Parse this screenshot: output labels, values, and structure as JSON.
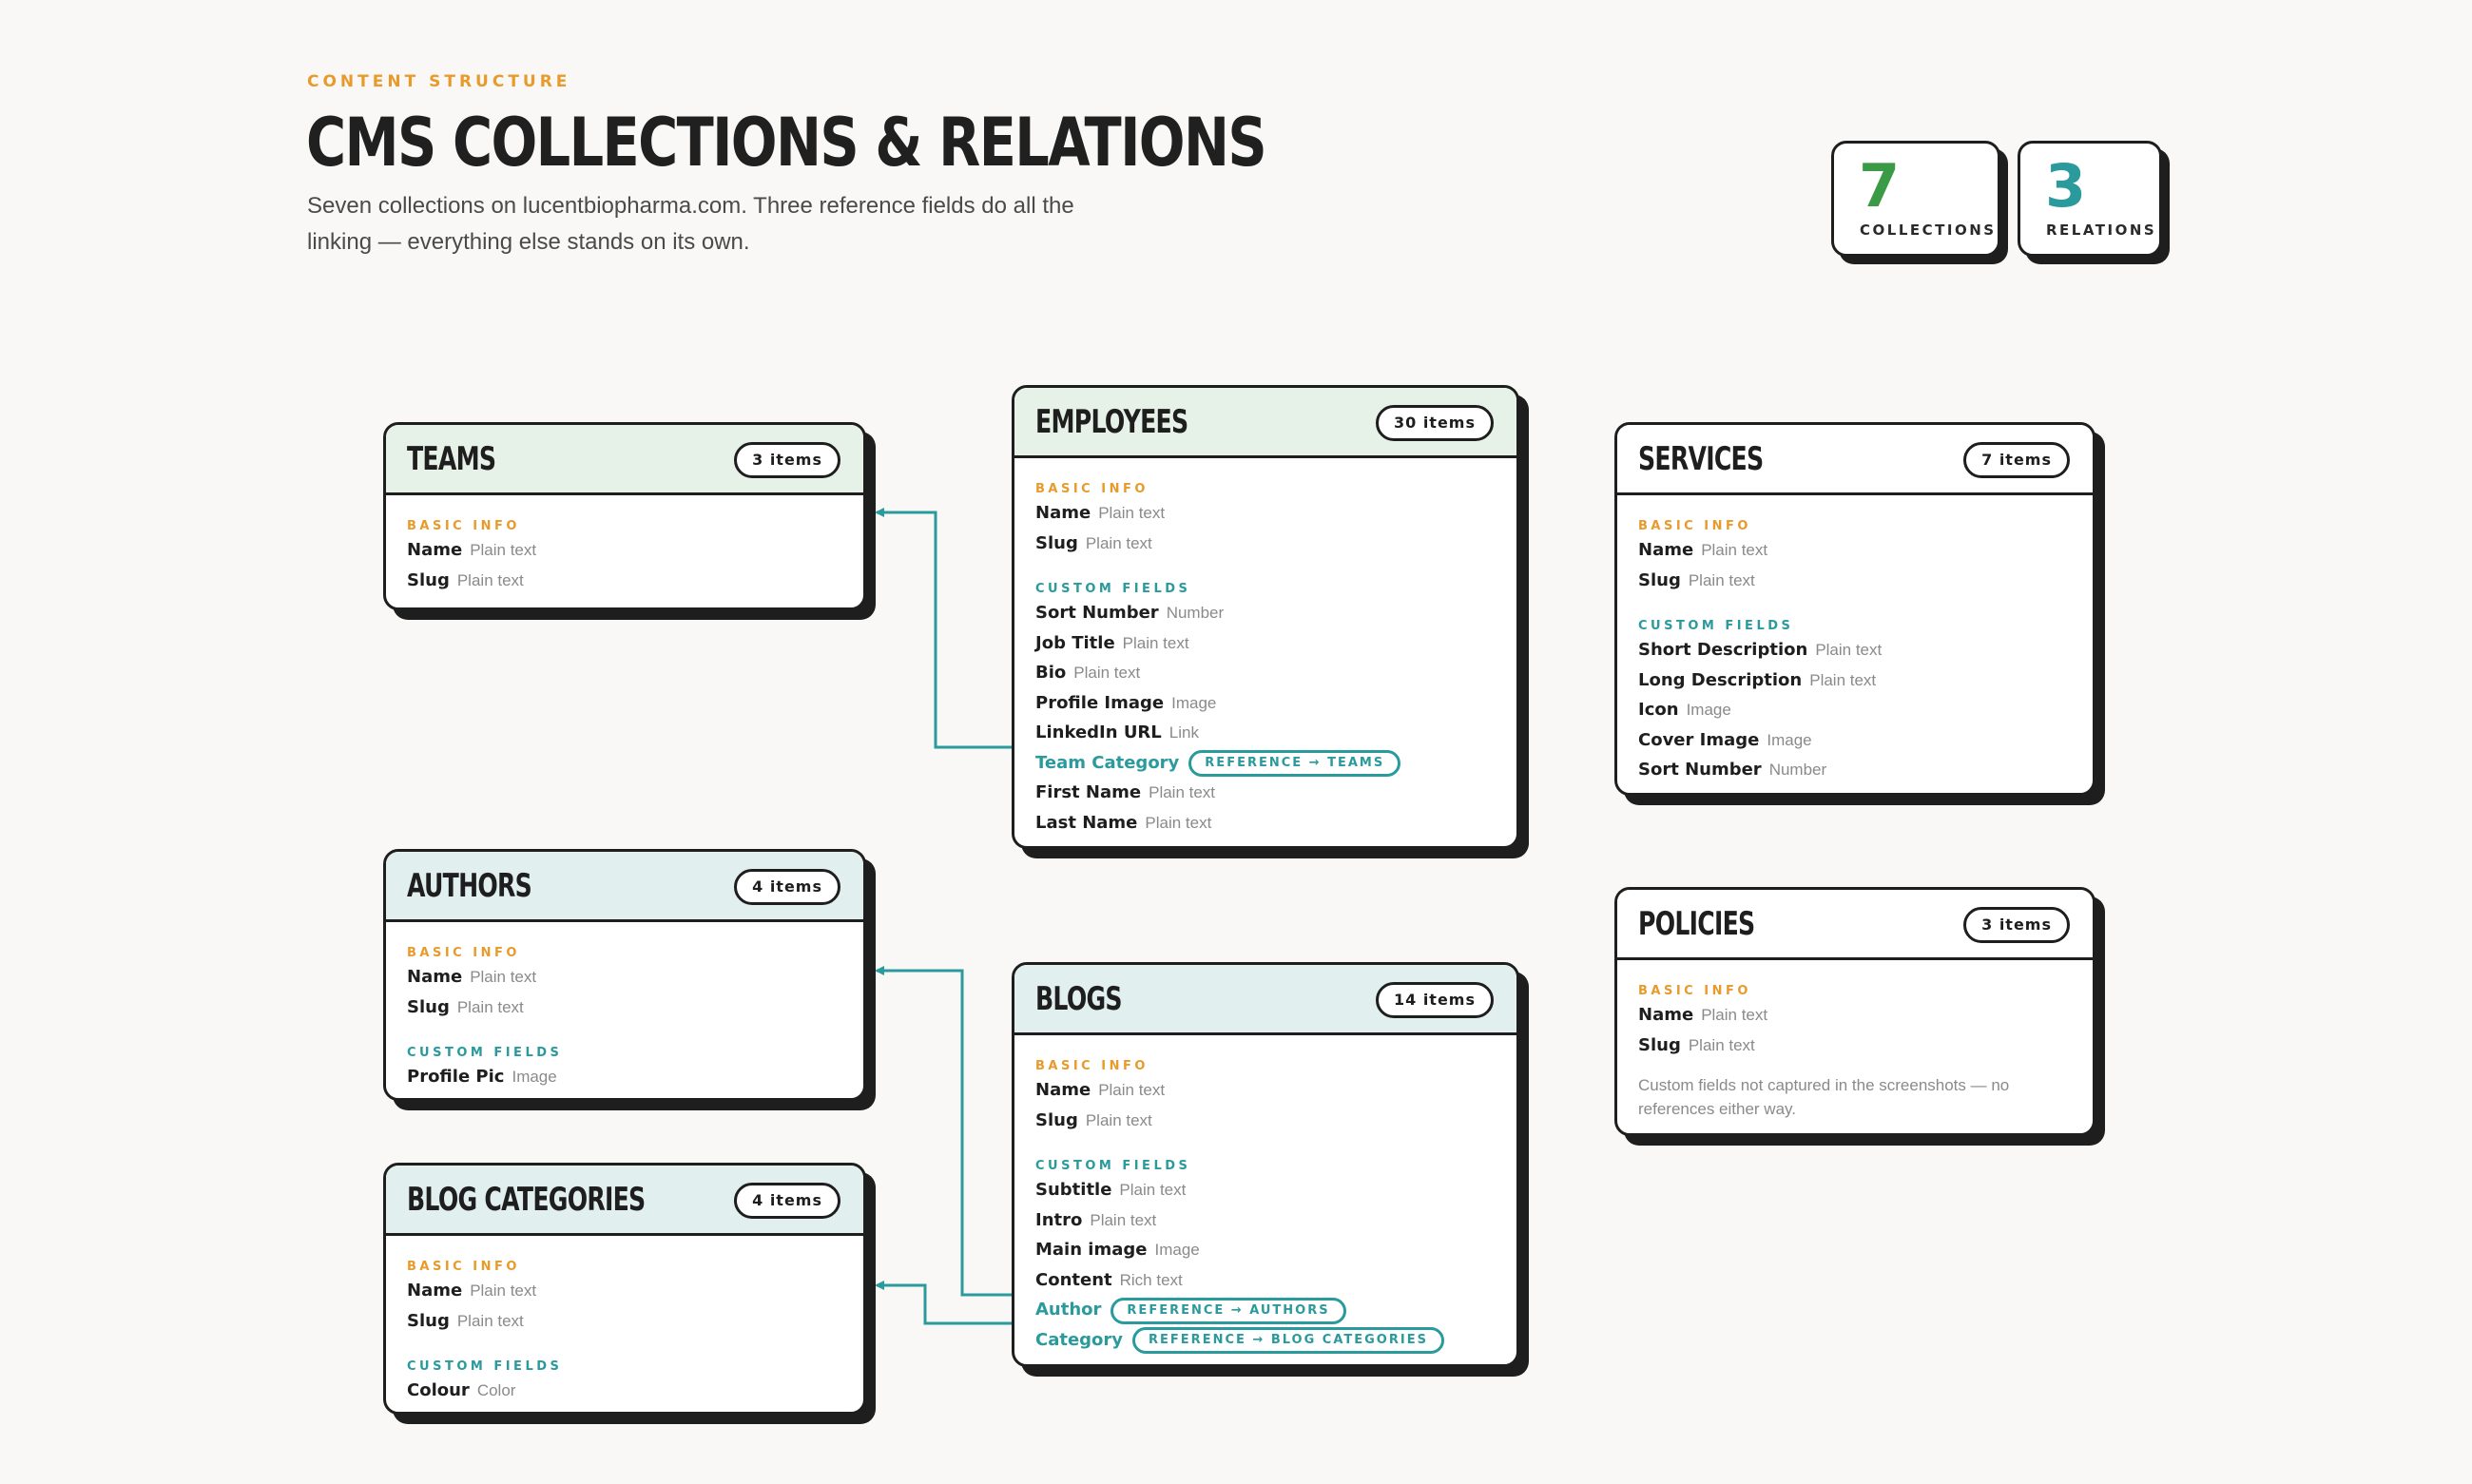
{
  "header": {
    "eyebrow": "CONTENT STRUCTURE",
    "title": "CMS COLLECTIONS & RELATIONS",
    "subtitle": "Seven collections on lucentbiopharma.com. Three reference fields do all the linking — everything else stands on its own."
  },
  "stats": [
    {
      "value": "7",
      "label": "COLLECTIONS",
      "color": "#3a9a45"
    },
    {
      "value": "3",
      "label": "RELATIONS",
      "color": "#2a9a9c"
    }
  ],
  "colors": {
    "head_green": "#e6f2e7",
    "head_blue": "#e2efef",
    "reference": "#2a9a9c",
    "basic_info": "#e89a2b",
    "ink": "#1e1e1e"
  },
  "cards": {
    "teams": {
      "name": "TEAMS",
      "count": "3 items",
      "tint": "green",
      "sections": [
        {
          "label": "BASIC INFO",
          "kind": "basic",
          "fields": [
            {
              "name": "Name",
              "type": "Plain text"
            },
            {
              "name": "Slug",
              "type": "Plain text"
            }
          ]
        }
      ]
    },
    "employees": {
      "name": "EMPLOYEES",
      "count": "30 items",
      "tint": "green",
      "sections": [
        {
          "label": "BASIC INFO",
          "kind": "basic",
          "fields": [
            {
              "name": "Name",
              "type": "Plain text"
            },
            {
              "name": "Slug",
              "type": "Plain text"
            }
          ]
        },
        {
          "label": "CUSTOM FIELDS",
          "kind": "custom",
          "fields": [
            {
              "name": "Sort Number",
              "type": "Number"
            },
            {
              "name": "Job Title",
              "type": "Plain text"
            },
            {
              "name": "Bio",
              "type": "Plain text"
            },
            {
              "name": "Profile Image",
              "type": "Image"
            },
            {
              "name": "LinkedIn URL",
              "type": "Link"
            },
            {
              "name": "Team Category",
              "ref": "REFERENCE → TEAMS"
            },
            {
              "name": "First Name",
              "type": "Plain text"
            },
            {
              "name": "Last Name",
              "type": "Plain text"
            }
          ]
        }
      ]
    },
    "services": {
      "name": "SERVICES",
      "count": "7 items",
      "tint": "white",
      "sections": [
        {
          "label": "BASIC INFO",
          "kind": "basic",
          "fields": [
            {
              "name": "Name",
              "type": "Plain text"
            },
            {
              "name": "Slug",
              "type": "Plain text"
            }
          ]
        },
        {
          "label": "CUSTOM FIELDS",
          "kind": "custom",
          "fields": [
            {
              "name": "Short Description",
              "type": "Plain text"
            },
            {
              "name": "Long Description",
              "type": "Plain text"
            },
            {
              "name": "Icon",
              "type": "Image"
            },
            {
              "name": "Cover Image",
              "type": "Image"
            },
            {
              "name": "Sort Number",
              "type": "Number"
            }
          ]
        }
      ]
    },
    "authors": {
      "name": "AUTHORS",
      "count": "4 items",
      "tint": "blue",
      "sections": [
        {
          "label": "BASIC INFO",
          "kind": "basic",
          "fields": [
            {
              "name": "Name",
              "type": "Plain text"
            },
            {
              "name": "Slug",
              "type": "Plain text"
            }
          ]
        },
        {
          "label": "CUSTOM FIELDS",
          "kind": "custom",
          "fields": [
            {
              "name": "Profile Pic",
              "type": "Image"
            }
          ]
        }
      ]
    },
    "blogs": {
      "name": "BLOGS",
      "count": "14 items",
      "tint": "blue",
      "sections": [
        {
          "label": "BASIC INFO",
          "kind": "basic",
          "fields": [
            {
              "name": "Name",
              "type": "Plain text"
            },
            {
              "name": "Slug",
              "type": "Plain text"
            }
          ]
        },
        {
          "label": "CUSTOM FIELDS",
          "kind": "custom",
          "fields": [
            {
              "name": "Subtitle",
              "type": "Plain text"
            },
            {
              "name": "Intro",
              "type": "Plain text"
            },
            {
              "name": "Main image",
              "type": "Image"
            },
            {
              "name": "Content",
              "type": "Rich text"
            },
            {
              "name": "Author",
              "ref": "REFERENCE → AUTHORS"
            },
            {
              "name": "Category",
              "ref": "REFERENCE → BLOG CATEGORIES"
            }
          ]
        }
      ]
    },
    "policies": {
      "name": "POLICIES",
      "count": "3 items",
      "tint": "white",
      "note": "Custom fields not captured in the screenshots — no references either way.",
      "sections": [
        {
          "label": "BASIC INFO",
          "kind": "basic",
          "fields": [
            {
              "name": "Name",
              "type": "Plain text"
            },
            {
              "name": "Slug",
              "type": "Plain text"
            }
          ]
        }
      ]
    },
    "blog_categories": {
      "name": "BLOG CATEGORIES",
      "count": "4 items",
      "tint": "blue",
      "sections": [
        {
          "label": "BASIC INFO",
          "kind": "basic",
          "fields": [
            {
              "name": "Name",
              "type": "Plain text"
            },
            {
              "name": "Slug",
              "type": "Plain text"
            }
          ]
        },
        {
          "label": "CUSTOM FIELDS",
          "kind": "custom",
          "fields": [
            {
              "name": "Colour",
              "type": "Color"
            }
          ]
        }
      ]
    }
  }
}
